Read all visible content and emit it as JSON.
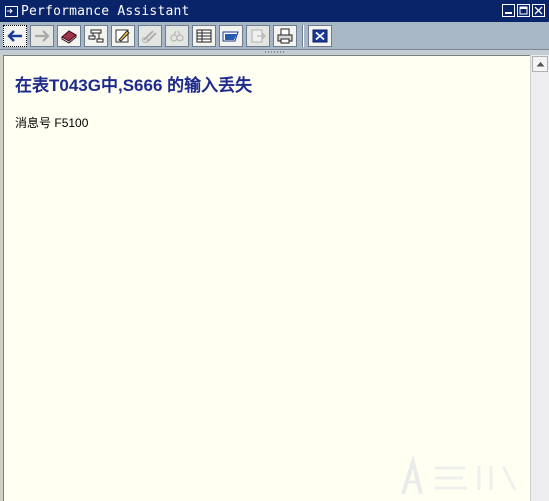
{
  "window": {
    "title": "Performance Assistant"
  },
  "toolbar": {
    "buttons": [
      {
        "name": "back-button",
        "icon": "arrow-left-icon",
        "enabled": true
      },
      {
        "name": "forward-button",
        "icon": "arrow-right-icon",
        "enabled": false
      },
      {
        "name": "technical-info-button",
        "icon": "book-icon",
        "enabled": true
      },
      {
        "name": "settings-button",
        "icon": "hierarchy-icon",
        "enabled": true
      },
      {
        "name": "edit-button",
        "icon": "pencil-icon",
        "enabled": true
      },
      {
        "name": "find-button",
        "icon": "binoculars-icon",
        "enabled": false
      },
      {
        "name": "find-next-button",
        "icon": "binoculars-next-icon",
        "enabled": false
      },
      {
        "name": "table-button",
        "icon": "table-icon",
        "enabled": true
      },
      {
        "name": "folder-button",
        "icon": "folder-icon",
        "enabled": true
      },
      {
        "name": "export-button",
        "icon": "export-icon",
        "enabled": false
      },
      {
        "name": "print-button",
        "icon": "printer-icon",
        "enabled": true
      },
      {
        "name": "close-button",
        "icon": "close-icon",
        "enabled": true
      }
    ]
  },
  "content": {
    "heading": "在表T043G中,S666  的输入丢失",
    "message_label": "消息号",
    "message_number": "F5100"
  },
  "colors": {
    "title_bar": "#0a246a",
    "toolbar": "#a7b7c6",
    "content_bg": "#fffff2",
    "heading": "#1e2a8c"
  }
}
